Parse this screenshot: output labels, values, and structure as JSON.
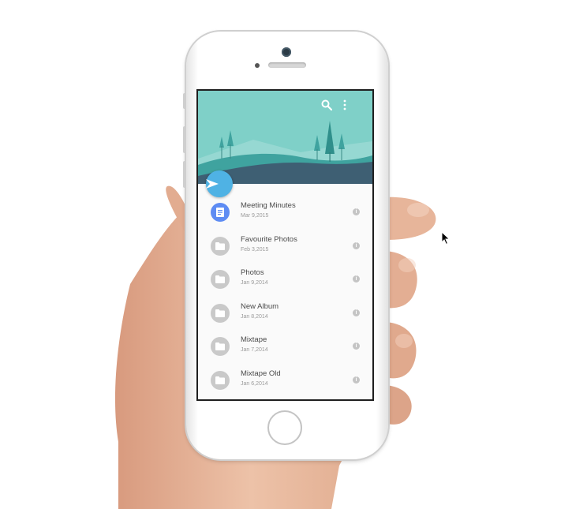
{
  "header": {
    "search_icon": "search-icon",
    "menu_icon": "more-vert-icon",
    "background_color": "#7fd0c8"
  },
  "fab": {
    "icon": "arrow-right-icon",
    "color": "#4fb2e4"
  },
  "files": [
    {
      "title": "Meeting Minutes",
      "date": "Mar 9,2015",
      "icon": "document-icon"
    },
    {
      "title": "Favourite Photos",
      "date": "Feb 3,2015",
      "icon": "folder-icon"
    },
    {
      "title": "Photos",
      "date": "Jan 9,2014",
      "icon": "folder-icon"
    },
    {
      "title": "New Album",
      "date": "Jan 8,2014",
      "icon": "folder-icon"
    },
    {
      "title": "Mixtape",
      "date": "Jan 7,2014",
      "icon": "folder-icon"
    },
    {
      "title": "Mixtape Old",
      "date": "Jan 6,2014",
      "icon": "folder-icon"
    }
  ]
}
